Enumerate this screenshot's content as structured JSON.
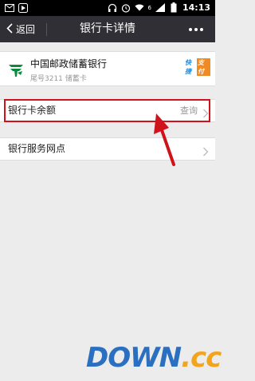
{
  "status_bar": {
    "time": "14:13",
    "network_label": "6",
    "icons": [
      "mail-icon",
      "play-icon",
      "headset-icon",
      "alarm-icon",
      "wifi-icon",
      "signal-icon",
      "battery-icon"
    ]
  },
  "header": {
    "back_label": "返回",
    "title": "银行卡详情",
    "more_icon": "more-dots-icon",
    "background": "#2f2f35"
  },
  "card": {
    "bank_name": "中国邮政储蓄银行",
    "meta": "尾号3211 储蓄卡",
    "badge_left": "快捷",
    "badge_right": "支付",
    "logo_color": "#0a8a3a"
  },
  "balance_row": {
    "label": "银行卡余额",
    "action": "查询",
    "highlight_color": "#d0121b"
  },
  "outlets_row": {
    "label": "银行服务网点"
  },
  "annotation": {
    "arrow_color": "#d0121b"
  },
  "watermark": {
    "part1": "DOWN",
    "part2": ".cc"
  }
}
